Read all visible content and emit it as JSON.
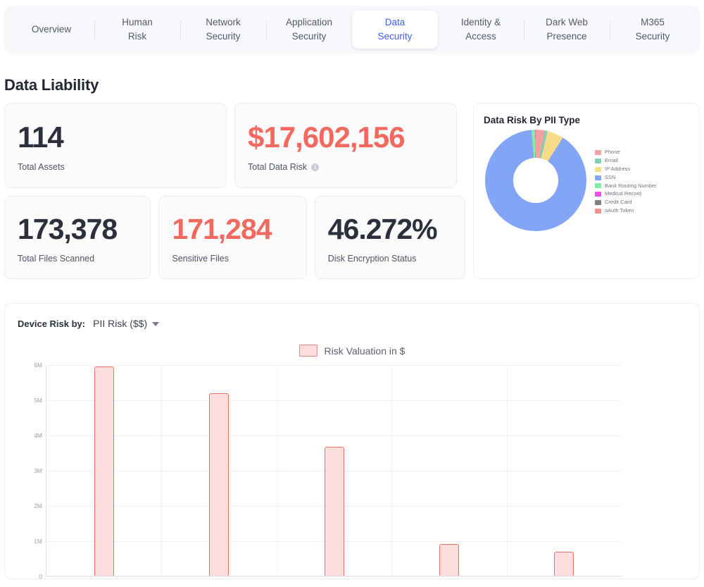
{
  "tabs": [
    {
      "name": "tab-overview",
      "lines": [
        "Overview"
      ],
      "active": false
    },
    {
      "name": "tab-human-risk",
      "lines": [
        "Human",
        "Risk"
      ],
      "active": false
    },
    {
      "name": "tab-network-security",
      "lines": [
        "Network",
        "Security"
      ],
      "active": false
    },
    {
      "name": "tab-application-security",
      "lines": [
        "Application",
        "Security"
      ],
      "active": false
    },
    {
      "name": "tab-data-security",
      "lines": [
        "Data",
        "Security"
      ],
      "active": true
    },
    {
      "name": "tab-identity-access",
      "lines": [
        "Identity &",
        "Access"
      ],
      "active": false
    },
    {
      "name": "tab-dark-web-presence",
      "lines": [
        "Dark Web",
        "Presence"
      ],
      "active": false
    },
    {
      "name": "tab-m365-security",
      "lines": [
        "M365",
        "Security"
      ],
      "active": false
    }
  ],
  "page": {
    "title": "Data Liability"
  },
  "metrics": {
    "total_assets": {
      "value": "114",
      "label": "Total Assets",
      "danger": false,
      "info": false
    },
    "total_data_risk": {
      "value": "$17,602,156",
      "label": "Total Data Risk",
      "danger": true,
      "info": true
    },
    "total_files_scanned": {
      "value": "173,378",
      "label": "Total Files Scanned",
      "danger": false,
      "info": false
    },
    "sensitive_files": {
      "value": "171,284",
      "label": "Sensitive Files",
      "danger": true,
      "info": false
    },
    "disk_encryption": {
      "value": "46.272%",
      "label": "Disk Encryption Status",
      "danger": false,
      "info": false
    },
    "info_glyph": "i"
  },
  "device_risk": {
    "label": "Device Risk by:",
    "selected_option": "PII Risk ($$)",
    "options": [
      "PII Risk ($$)"
    ]
  },
  "colors": {
    "accent_blue": "#3d63f0",
    "danger_red": "#f2695f",
    "bar_fill": "#fbdedd",
    "bar_stroke": "#e8716a",
    "card_bg": "#fbfbfc",
    "tabbar_bg": "#f7f8fc"
  },
  "chart_data": [
    {
      "type": "pie",
      "name": "data-risk-by-pii-type",
      "title": "Data Risk By PII Type",
      "legend_position": "right",
      "donut": true,
      "labels": [
        "Phone",
        "Email",
        "IP Address",
        "SSN",
        "Bank Routing Number",
        "Medical Record",
        "Credit Card",
        "oAuth Token"
      ],
      "colors": [
        "#f4a2a0",
        "#83cdb9",
        "#f8dc8a",
        "#82a6f5",
        "#7ef0a3",
        "#f84cf0",
        "#7c8189",
        "#f4918f"
      ],
      "values": [
        2.8,
        1.0,
        5.2,
        89.6,
        1.2,
        0.05,
        0.05,
        0.1
      ],
      "value_unit": "percent"
    },
    {
      "type": "bar",
      "name": "device-risk-bar-chart",
      "title": "",
      "legend": [
        "Risk Valuation in $"
      ],
      "series": [
        {
          "name": "Risk Valuation in $",
          "values": [
            5950000,
            5180000,
            3660000,
            900000,
            690000
          ]
        }
      ],
      "categories": [
        "",
        "",
        "",
        "",
        ""
      ],
      "ylabel": "",
      "xlabel": "",
      "ylim": [
        0,
        6000000
      ],
      "yticks": [
        0,
        1000000,
        2000000,
        3000000,
        4000000,
        5000000,
        6000000
      ],
      "ytick_labels": [
        "0",
        "1M",
        "2M",
        "3M",
        "4M",
        "5M",
        "6M"
      ],
      "grid": true
    }
  ]
}
